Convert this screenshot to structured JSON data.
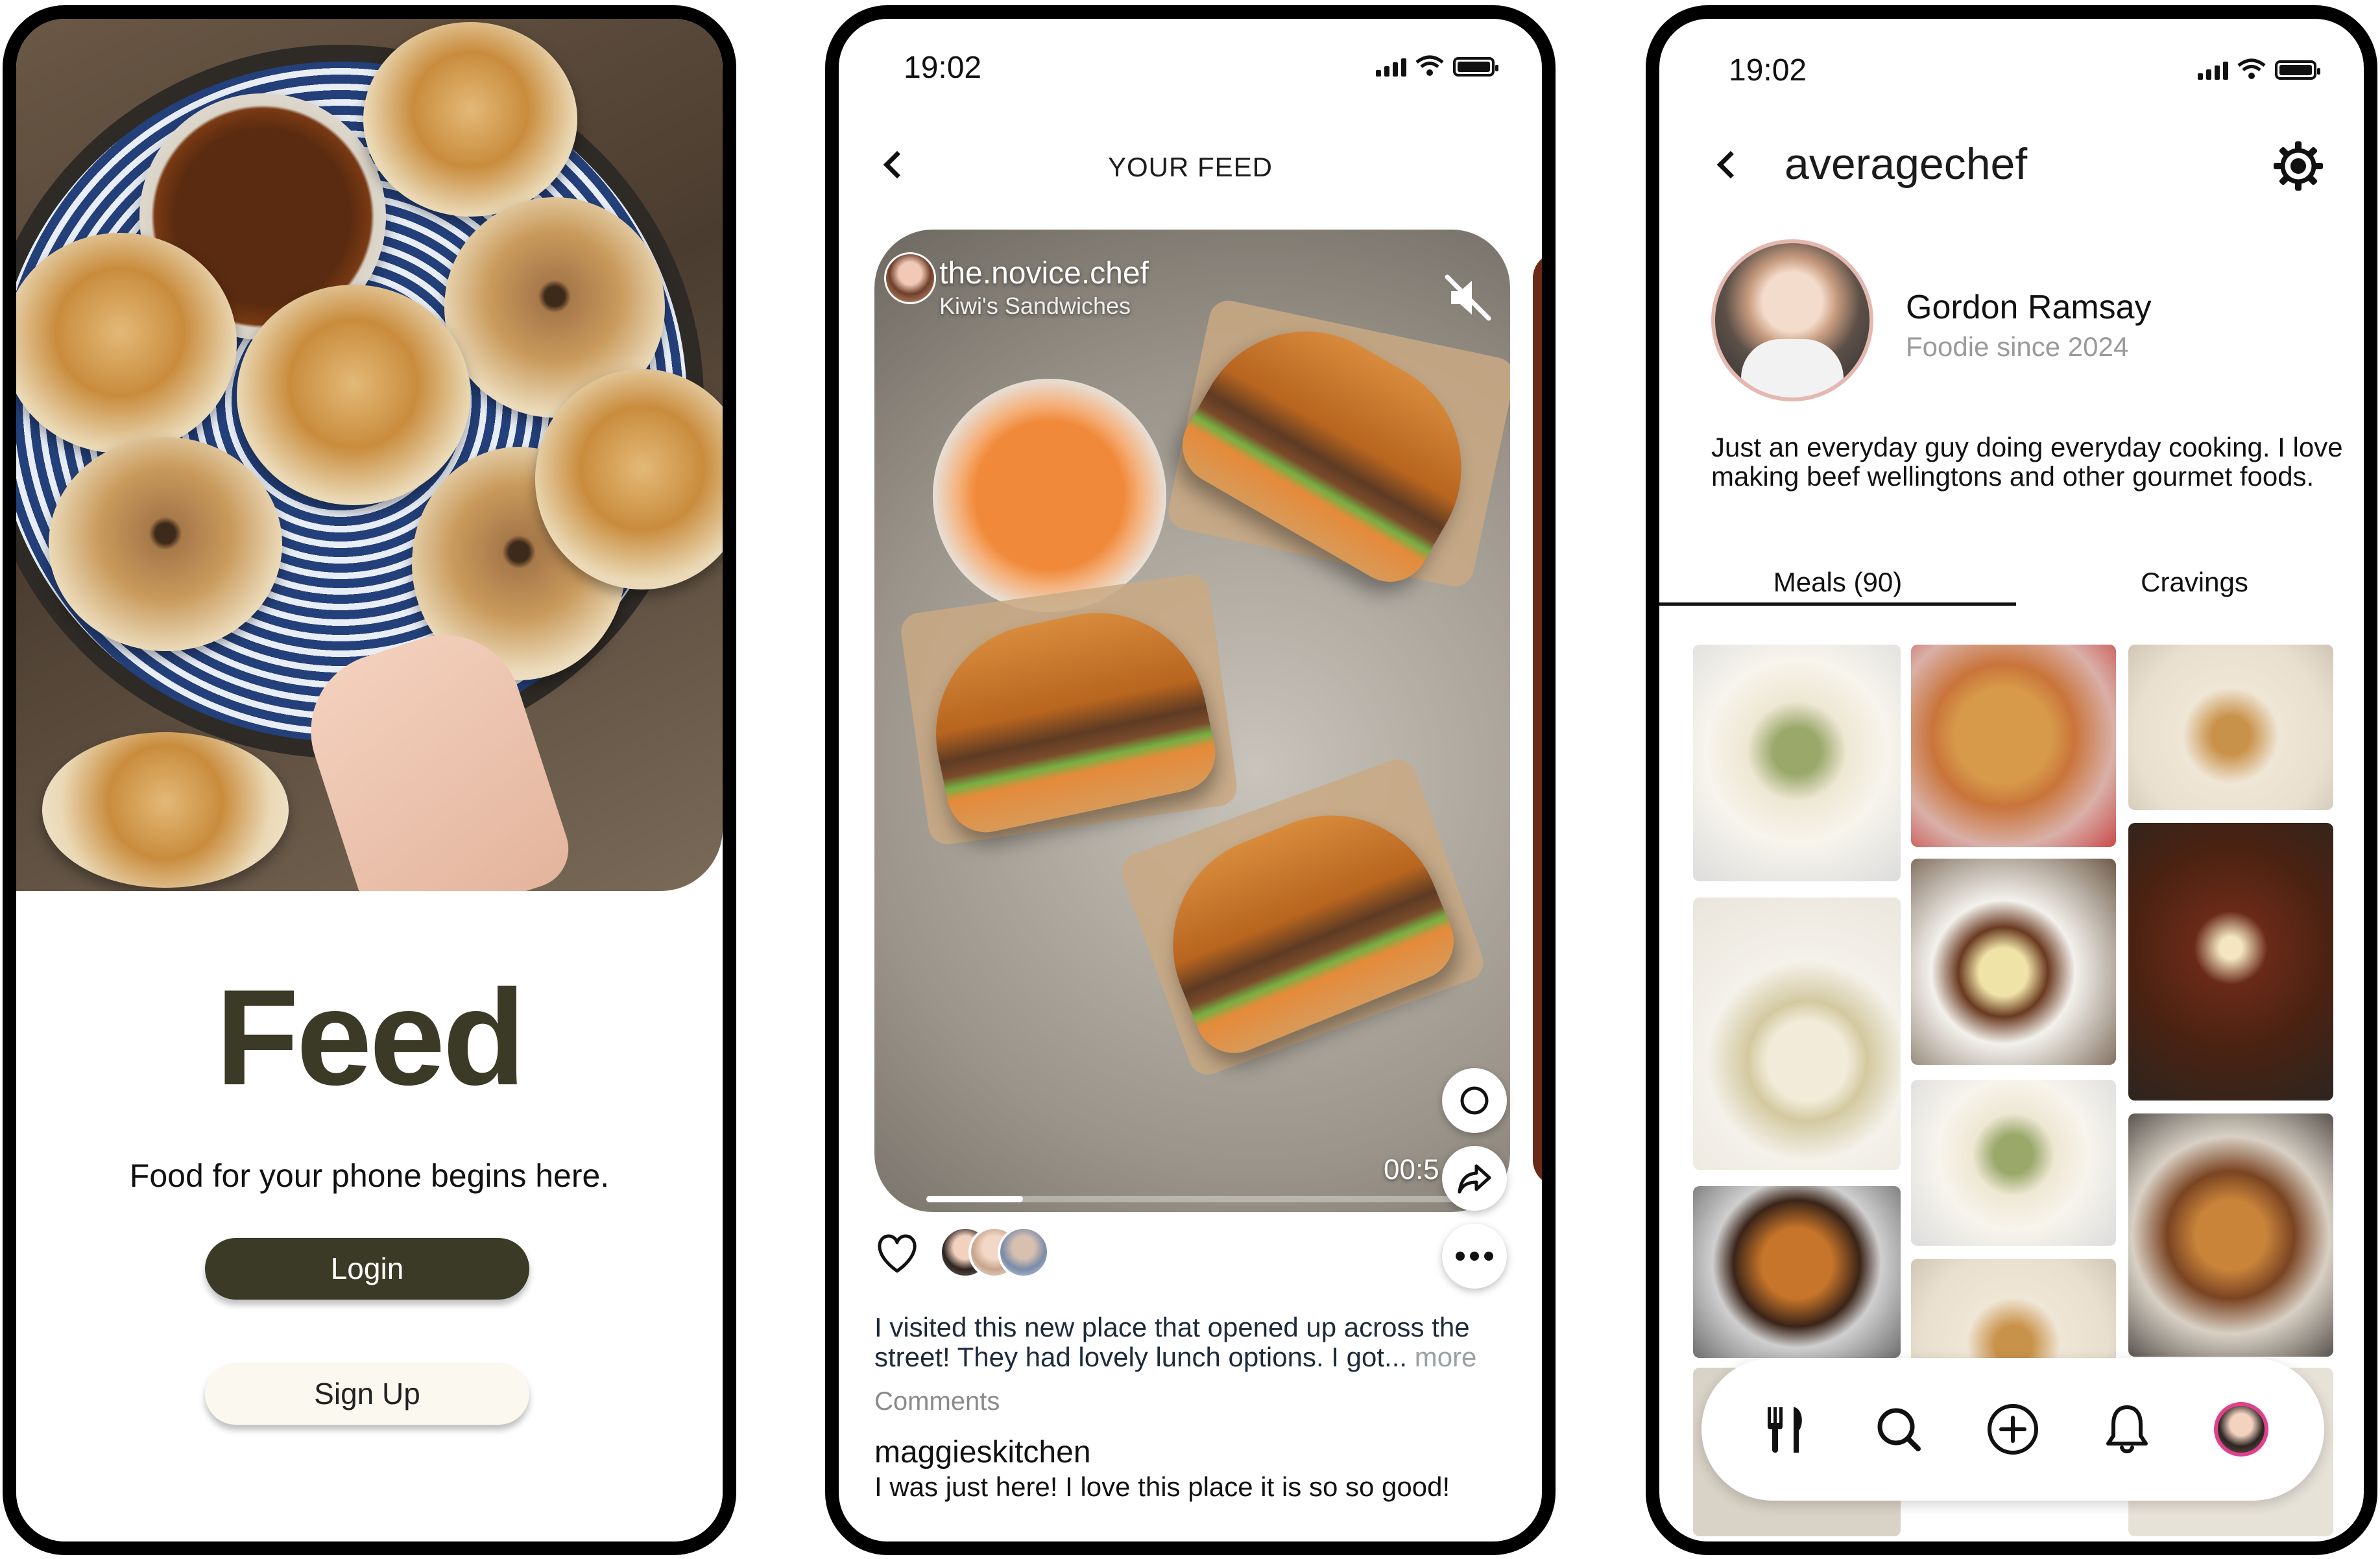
{
  "screen_login": {
    "app_name": "Feed",
    "tagline": "Food for your phone begins here.",
    "login_label": "Login",
    "signup_label": "Sign Up"
  },
  "screen_feed": {
    "status_time": "19:02",
    "header_title": "YOUR FEED",
    "post": {
      "username": "the.novice.chef",
      "subtitle": "Kiwi's Sandwiches",
      "timer": "00:5",
      "progress": 0.18,
      "caption": "I visited this new place that opened up across the street! They had lovely lunch options. I got...",
      "more_label": "more",
      "comments_label": "Comments",
      "comment": {
        "author": "maggieskitchen",
        "text": "I was just here! I love this place it is so so good!"
      }
    },
    "icons": [
      "back-chevron-icon",
      "mute-icon",
      "circle-icon",
      "share-icon",
      "heart-icon",
      "more-icon",
      "signal-icon",
      "wifi-icon",
      "battery-icon"
    ]
  },
  "screen_profile": {
    "status_time": "19:02",
    "username": "averagechef",
    "full_name": "Gordon Ramsay",
    "member_since": "Foodie since 2024",
    "bio": "Just an everyday guy doing everyday cooking. I love making beef wellingtons and other gourmet foods.",
    "tabs": [
      {
        "label": "Meals (90)",
        "active": true
      },
      {
        "label": "Cravings",
        "active": false
      }
    ],
    "nav": [
      "utensils-icon",
      "search-icon",
      "add-icon",
      "bell-icon",
      "profile-avatar-icon"
    ]
  },
  "colors": {
    "brand_dark": "#3a3a26",
    "signup_bg": "#fbf8ef",
    "avatar_ring": "#e0418c",
    "muted_text": "#9a9a9a"
  }
}
